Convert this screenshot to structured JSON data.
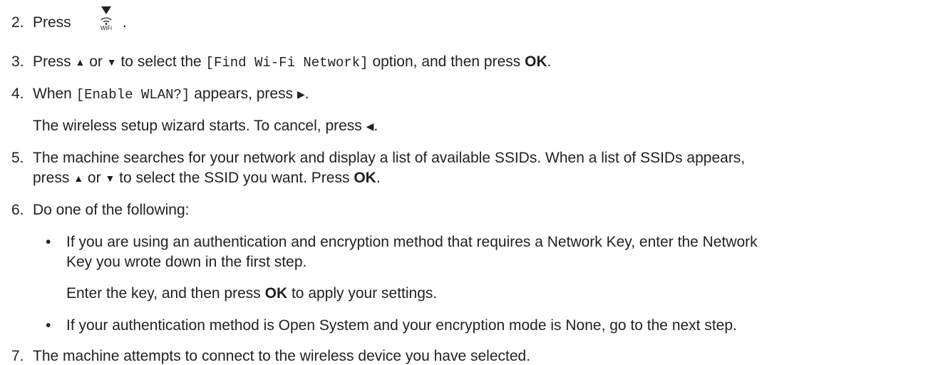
{
  "steps": {
    "s2": {
      "num": "2.",
      "text_before": "Press",
      "text_after": ".",
      "icon_name": "wifi-button-icon",
      "icon_label": "WiFi"
    },
    "s3": {
      "num": "3.",
      "t1": "Press",
      "up": "▲",
      "t2": "or",
      "down": "▼",
      "t3": "to select the",
      "option": "[Find Wi-Fi Network]",
      "t4": "option, and then press",
      "ok": "OK",
      "t5": "."
    },
    "s4": {
      "num": "4.",
      "t1": "When",
      "option": "[Enable WLAN?]",
      "t2": "appears, press",
      "right": "▶",
      "t3": ".",
      "sub": "The wireless setup wizard starts. To cancel, press",
      "left": "◀",
      "sub_end": "."
    },
    "s5": {
      "num": "5.",
      "line1": "The machine searches for your network and display a list of available SSIDs. When a list of SSIDs appears,",
      "l2_t1": "press",
      "up": "▲",
      "l2_t2": "or",
      "down": "▼",
      "l2_t3": "to select the SSID you want. Press",
      "ok": "OK",
      "l2_end": "."
    },
    "s6": {
      "num": "6.",
      "text": "Do one of the following:",
      "bullet1": {
        "line1": "If you are using an authentication and encryption method that requires a Network Key, enter the Network",
        "line2": "Key you wrote down in the first step.",
        "sub_t1": "Enter the key, and then press",
        "ok": "OK",
        "sub_t2": "to apply your settings."
      },
      "bullet2": {
        "line1": "If your authentication method is Open System and your encryption mode is None, go to the next step."
      },
      "bullet_char": "•"
    },
    "s7": {
      "num": "7.",
      "text": "The machine attempts to connect to the wireless device you have selected."
    }
  }
}
